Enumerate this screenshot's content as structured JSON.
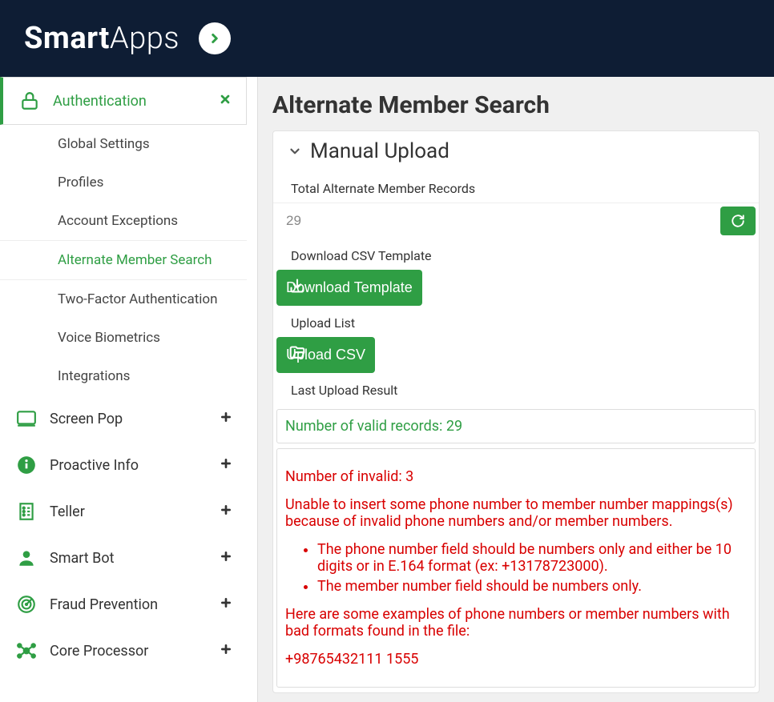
{
  "brand": {
    "bold": "Smart",
    "light": "Apps"
  },
  "sidebar": {
    "active_section": "Authentication",
    "subitems": [
      "Global Settings",
      "Profiles",
      "Account Exceptions",
      "Alternate Member Search",
      "Two-Factor Authentication",
      "Voice Biometrics",
      "Integrations"
    ],
    "active_sub_index": 3,
    "sections": [
      {
        "label": "Screen Pop",
        "icon": "monitor"
      },
      {
        "label": "Proactive Info",
        "icon": "info"
      },
      {
        "label": "Teller",
        "icon": "receipt"
      },
      {
        "label": "Smart Bot",
        "icon": "user"
      },
      {
        "label": "Fraud Prevention",
        "icon": "radar"
      },
      {
        "label": "Core Processor",
        "icon": "network"
      }
    ]
  },
  "main": {
    "title": "Alternate Member Search",
    "panel_title": "Manual Upload",
    "total_label": "Total Alternate Member Records",
    "total_value": "29",
    "download_label": "Download CSV Template",
    "download_btn": "Download Template",
    "upload_label": "Upload List",
    "upload_btn": "Upload CSV",
    "last_upload_label": "Last Upload Result",
    "valid_msg": "Number of valid records: 29",
    "invalid": {
      "count_line": "Number of invalid: 3",
      "explain": "Unable to insert some phone number to member number mappings(s) because of invalid phone numbers and/or member numbers.",
      "bullets": [
        "The phone number field should be numbers only and either be 10 digits or in E.164 format (ex: +13178723000).",
        "The member number field should be numbers only."
      ],
      "examples_intro": "Here are some examples of phone numbers or member numbers with bad formats found in the file:",
      "example": "+98765432111 1555"
    }
  }
}
